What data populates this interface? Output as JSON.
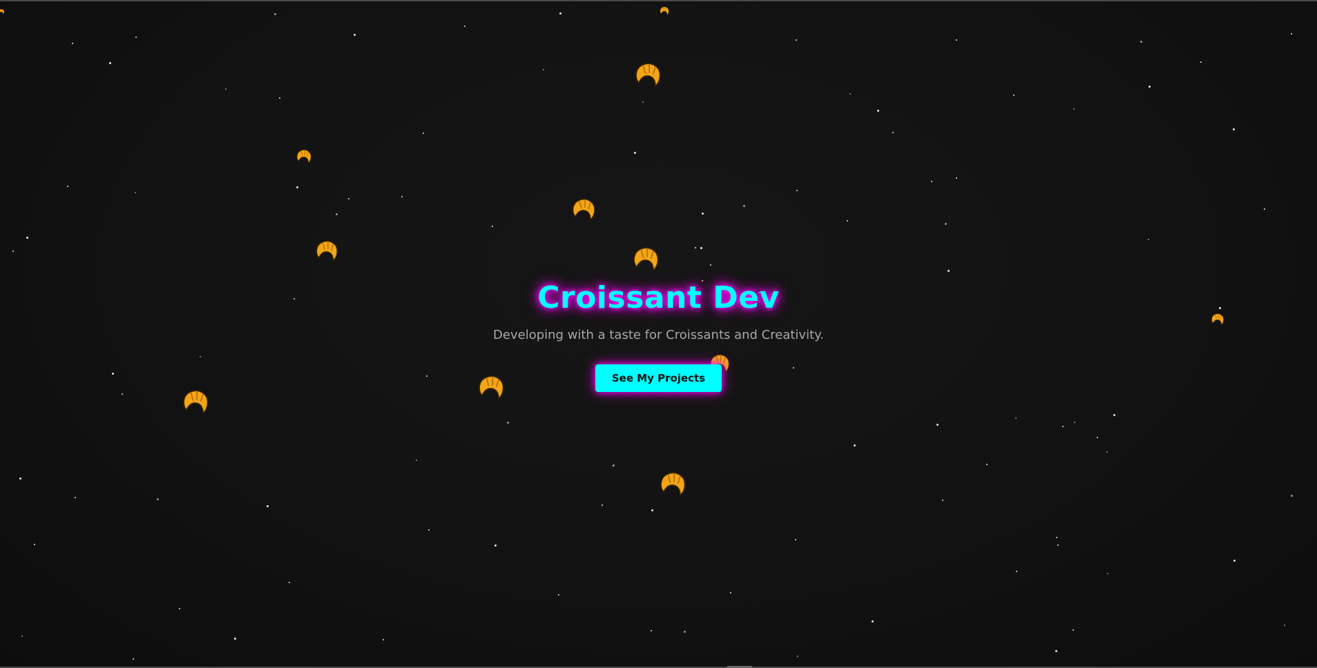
{
  "hero": {
    "title": "Croissant Dev",
    "subtitle": "Developing with a taste for Croissants and Creativity.",
    "cta_label": "See My Projects"
  },
  "colors": {
    "background": "#121212",
    "accent": "#00ffff",
    "glow": "#ff00ff",
    "subtitle": "#a8a8a8",
    "star": "#ffffff",
    "croissant": "#f2a516"
  },
  "decorations": {
    "croissant_icon": "croissant-icon",
    "star_icon": "star-dot"
  }
}
